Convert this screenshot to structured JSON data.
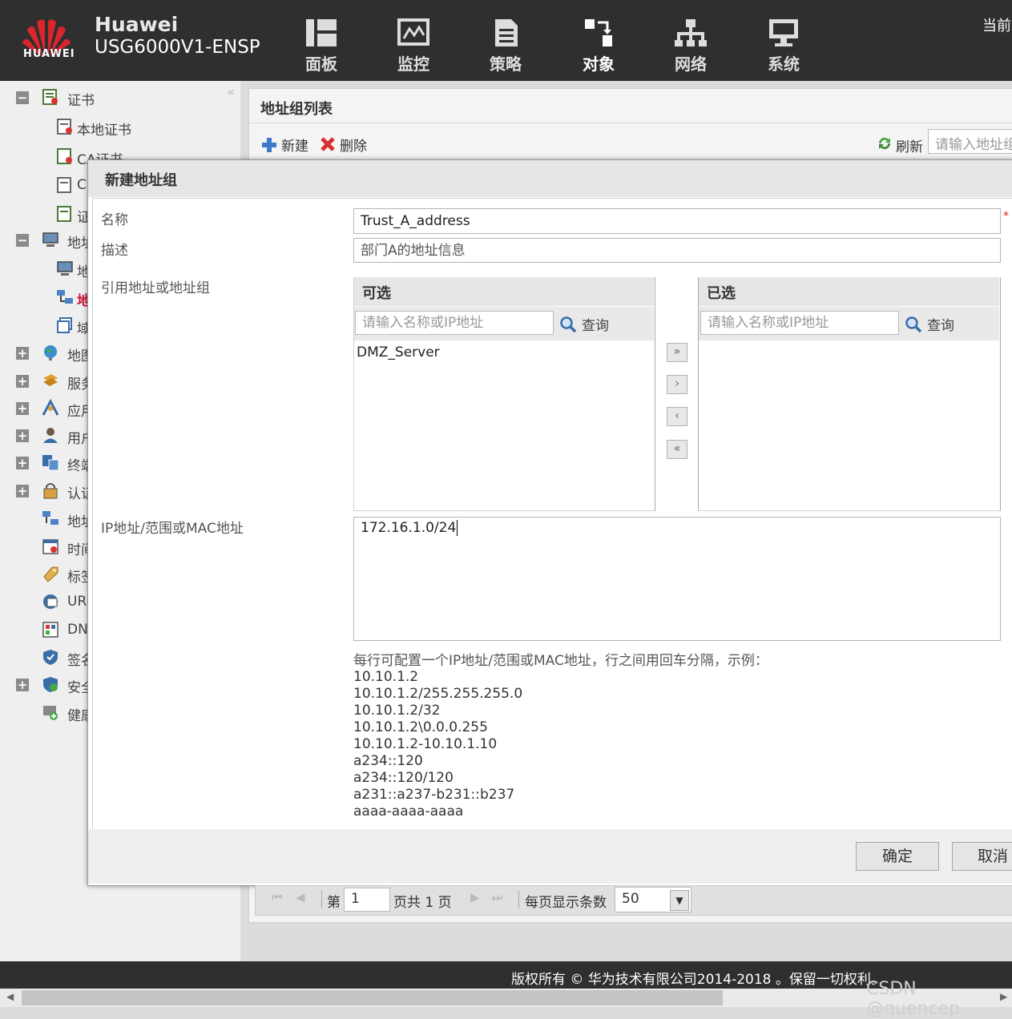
{
  "header": {
    "logo_text": "HUAWEI",
    "brand": "Huawei",
    "model": "USG6000V1-ENSP",
    "nav": [
      {
        "label": "面板",
        "icon": "dashboard-icon"
      },
      {
        "label": "监控",
        "icon": "monitor-icon"
      },
      {
        "label": "策略",
        "icon": "policy-icon"
      },
      {
        "label": "对象",
        "icon": "object-icon"
      },
      {
        "label": "网络",
        "icon": "network-icon"
      },
      {
        "label": "系统",
        "icon": "system-icon"
      }
    ],
    "current_label": "当前"
  },
  "sidebar": {
    "collapse_glyph": "«",
    "items": [
      {
        "toggle": "−",
        "label": "证书"
      },
      {
        "label": "本地证书"
      },
      {
        "label": "CA证书"
      },
      {
        "label": "C"
      },
      {
        "label": "证"
      },
      {
        "toggle": "−",
        "label": "地址"
      },
      {
        "label": "地"
      },
      {
        "label": "地"
      },
      {
        "label": "域"
      },
      {
        "toggle": "+",
        "label": "地图"
      },
      {
        "toggle": "+",
        "label": "服务"
      },
      {
        "toggle": "+",
        "label": "应用"
      },
      {
        "toggle": "+",
        "label": "用户"
      },
      {
        "toggle": "+",
        "label": "终端"
      },
      {
        "toggle": "+",
        "label": "认证"
      },
      {
        "label": "地址"
      },
      {
        "label": "时间"
      },
      {
        "label": "标签"
      },
      {
        "label": "UR"
      },
      {
        "label": "DN"
      },
      {
        "label": "签名"
      },
      {
        "toggle": "+",
        "label": "安全"
      },
      {
        "label": "健康"
      }
    ]
  },
  "main": {
    "title": "地址组列表",
    "toolbar": {
      "new_label": "新建",
      "delete_label": "删除",
      "refresh_label": "刷新",
      "search_placeholder": "请输入地址组"
    }
  },
  "dialog": {
    "title": "新建地址组",
    "name_label": "名称",
    "name_value": "Trust_A_address",
    "required_mark": "*",
    "desc_label": "描述",
    "desc_value": "部门A的地址信息",
    "ref_label": "引用地址或地址组",
    "available": {
      "header": "可选",
      "search_placeholder": "请输入名称或IP地址",
      "search_button": "查询",
      "items": [
        "DMZ_Server"
      ]
    },
    "selected": {
      "header": "已选",
      "search_placeholder": "请输入名称或IP地址",
      "search_button": "查询",
      "items": []
    },
    "move_buttons": [
      "»",
      "›",
      "‹",
      "«"
    ],
    "ip_label": "IP地址/范围或MAC地址",
    "ip_value": "172.16.1.0/24",
    "hint_title": "每行可配置一个IP地址/范围或MAC地址，行之间用回车分隔，示例：",
    "hint_examples": [
      "10.10.1.2",
      "10.10.1.2/255.255.255.0",
      "10.10.1.2/32",
      "10.10.1.2\\0.0.0.255",
      "10.10.1.2-10.10.1.10",
      "a234::120",
      "a234::120/120",
      "a231::a237-b231::b237",
      "aaaa-aaaa-aaaa"
    ],
    "ok_label": "确定",
    "cancel_label": "取消"
  },
  "pager": {
    "page_prefix": "第",
    "page_value": "1",
    "page_suffix": "页共 1 页",
    "per_page_label": "每页显示条数",
    "per_page_value": "50"
  },
  "footer": {
    "copyright": "版权所有 © 华为技术有限公司2014-2018 。保留一切权利。",
    "watermark": "CSDN @quencep"
  },
  "colors": {
    "header_bg": "#2f2f2f",
    "logo_red": "#d9262c",
    "required_red": "#e02020"
  }
}
